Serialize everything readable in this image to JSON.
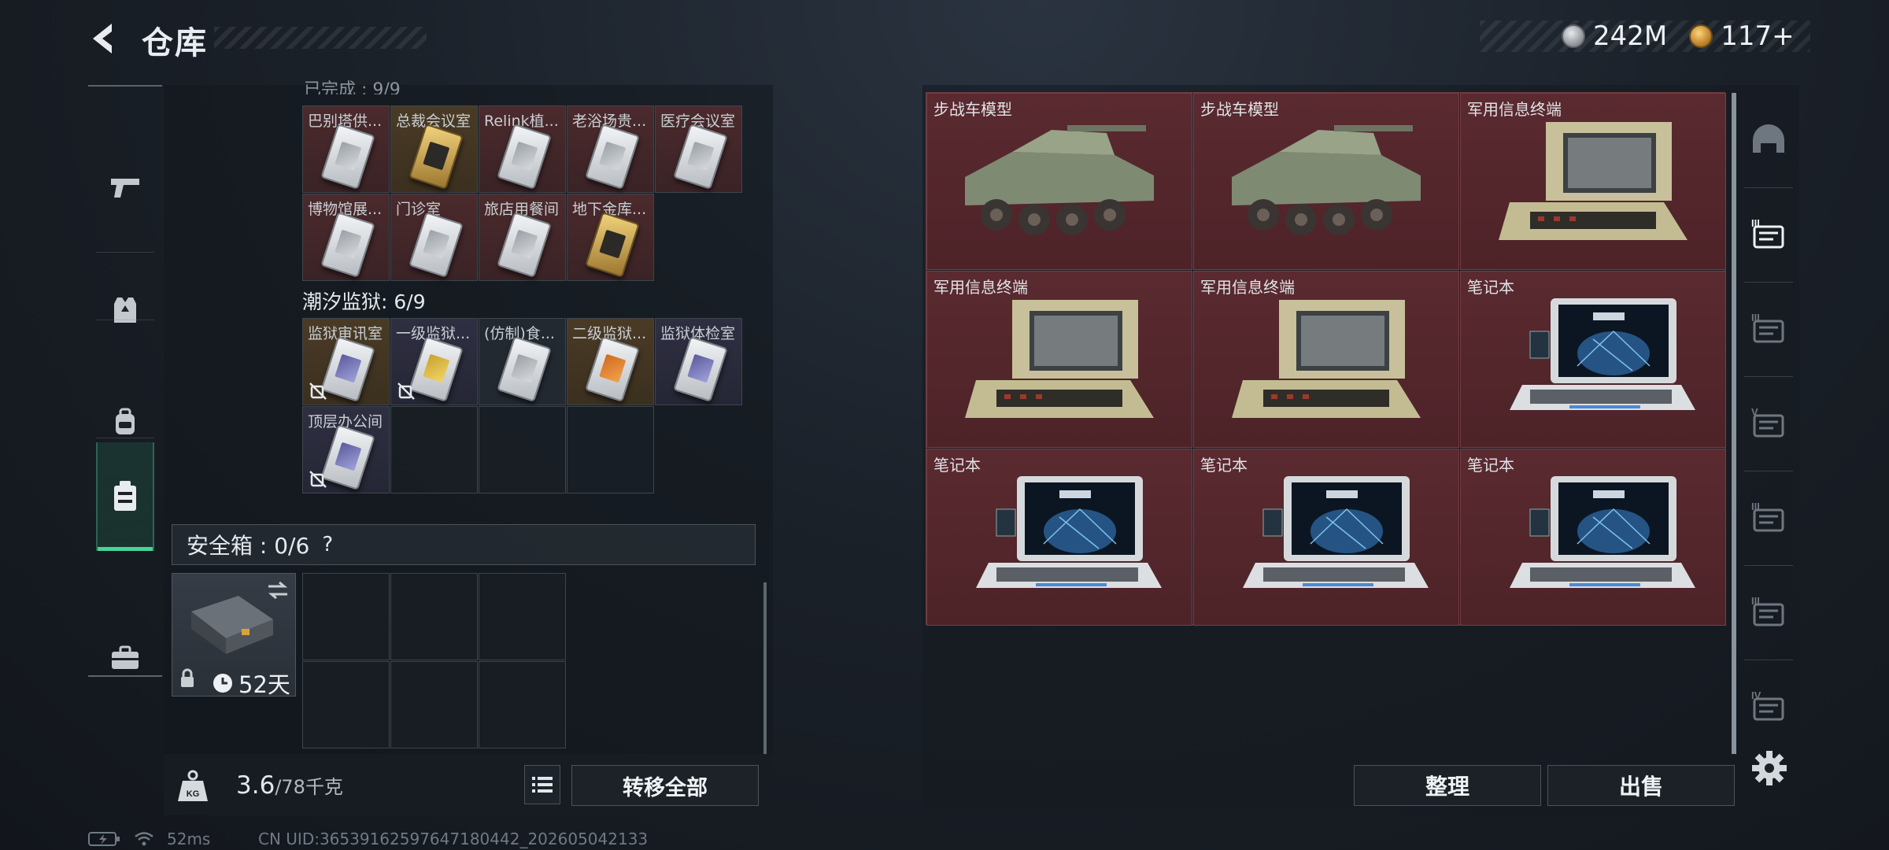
{
  "header": {
    "title": "仓库",
    "currency": [
      {
        "name": "silver-coin-icon",
        "value": "242M"
      },
      {
        "name": "gold-coin-icon",
        "value": "117+"
      }
    ]
  },
  "side_nav": {
    "items": [
      {
        "name": "weapon",
        "icon": "pistol-icon"
      },
      {
        "name": "armor",
        "icon": "vest-icon"
      },
      {
        "name": "backpack",
        "icon": "backpack-icon"
      },
      {
        "name": "keycards",
        "icon": "keycard-case-icon",
        "active": true
      },
      {
        "name": "toolbox",
        "icon": "briefcase-icon"
      }
    ]
  },
  "inventory": {
    "partial_header": "已完成 : 9/9",
    "group1": {
      "cells": [
        {
          "label": "巴别塔供...",
          "style": "red",
          "card": "white"
        },
        {
          "label": "总裁会议室",
          "style": "gold",
          "card": "gold"
        },
        {
          "label": "Relink植...",
          "style": "red",
          "card": "white"
        },
        {
          "label": "老浴场贵...",
          "style": "red",
          "card": "white"
        },
        {
          "label": "医疗会议室",
          "style": "red",
          "card": "white"
        },
        {
          "label": "博物馆展...",
          "style": "red",
          "card": "white"
        },
        {
          "label": "门诊室",
          "style": "red",
          "card": "white"
        },
        {
          "label": "旅店用餐间",
          "style": "red",
          "card": "white"
        },
        {
          "label": "地下金库...",
          "style": "red",
          "card": "gold"
        }
      ]
    },
    "group2": {
      "title": "潮汐监狱: 6/9",
      "cells": [
        {
          "label": "监狱审讯室",
          "style": "gold",
          "card": "purple",
          "no_icon": true
        },
        {
          "label": "一级监狱...",
          "style": "purple",
          "card": "yellow",
          "no_icon": true
        },
        {
          "label": "(仿制)食...",
          "style": "dark",
          "card": "white"
        },
        {
          "label": "二级监狱...",
          "style": "gold",
          "card": "orange"
        },
        {
          "label": "监狱体检室",
          "style": "purple",
          "card": "purple"
        },
        {
          "label": "顶层办公间",
          "style": "purple",
          "card": "purple",
          "no_icon": true
        }
      ]
    },
    "safe_box": {
      "label": "安全箱 : 0/6",
      "help": "?",
      "duration": "52天"
    },
    "weight": {
      "current": "3.6",
      "capacity": "/78千克"
    },
    "transfer_all": "转移全部"
  },
  "loot": {
    "items": [
      {
        "label": "步战车模型",
        "kind": "vehicle"
      },
      {
        "label": "步战车模型",
        "kind": "vehicle"
      },
      {
        "label": "军用信息终端",
        "kind": "terminal"
      },
      {
        "label": "军用信息终端",
        "kind": "terminal"
      },
      {
        "label": "军用信息终端",
        "kind": "terminal"
      },
      {
        "label": "笔记本",
        "kind": "laptop"
      },
      {
        "label": "笔记本",
        "kind": "laptop"
      },
      {
        "label": "笔记本",
        "kind": "laptop"
      },
      {
        "label": "笔记本",
        "kind": "laptop"
      }
    ],
    "sort_button": "整理",
    "sell_button": "出售"
  },
  "right_tabs": [
    {
      "icon": "helmet-icon"
    },
    {
      "icon": "tier-3-rig-icon",
      "text": "III",
      "active": true
    },
    {
      "icon": "tier-3-rig-icon",
      "text": "III"
    },
    {
      "icon": "tier-5-armor-icon",
      "text": "V"
    },
    {
      "icon": "tier-3-rig-icon",
      "text": "III"
    },
    {
      "icon": "tier-3-rig-icon",
      "text": "III"
    },
    {
      "icon": "tier-4-armor-icon",
      "text": "IV"
    }
  ],
  "status_bar": {
    "ping": "52ms",
    "uid": "CN UID:3653916259764718044​2_202605042133"
  },
  "colors": {
    "accent_green": "#49d39a",
    "loot_bg": "#5a2a30",
    "panel_bg": "#171c22"
  }
}
